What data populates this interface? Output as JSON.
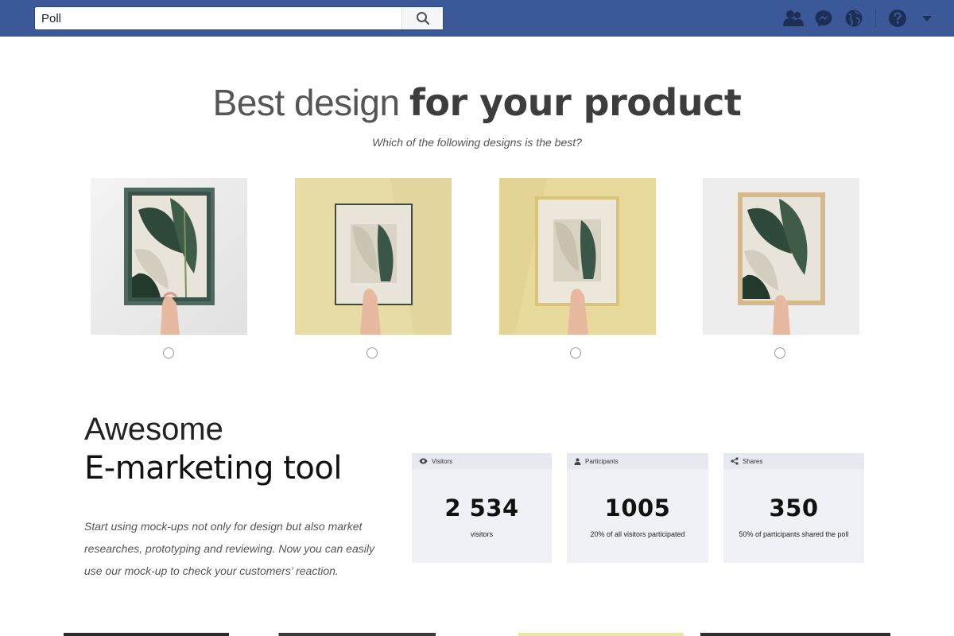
{
  "search": {
    "value": "Poll"
  },
  "nav": {
    "icons": [
      "friends-icon",
      "messenger-icon",
      "globe-icon",
      "help-icon",
      "caret-down-icon"
    ]
  },
  "hero": {
    "title_light": "Best design ",
    "title_bold": "for your product",
    "subtitle": "Which of the following designs is the best?"
  },
  "designs": [
    {
      "frame": "dark green frame",
      "bg": "#efefef",
      "frame_color": "#4f6a61"
    },
    {
      "frame": "thin dark frame with mat",
      "bg": "#e5d8a0",
      "frame_color": "#3d4a3a"
    },
    {
      "frame": "gold frame with mat",
      "bg": "#e6d79c",
      "frame_color": "#d8c47a"
    },
    {
      "frame": "light wood frame",
      "bg": "#eeeeee",
      "frame_color": "#d7b98d"
    }
  ],
  "marketing": {
    "line1": "Awesome",
    "line2": "E-marketing tool",
    "description": "Start using mock-ups not only for design but also market researches, prototyping and reviewing. Now you can easily use our mock-up to check your customers’ reaction."
  },
  "stats": [
    {
      "label": "Visitors",
      "icon": "eye-icon",
      "value": "2 534",
      "note": "visitors"
    },
    {
      "label": "Participants",
      "icon": "user-icon",
      "value": "1005",
      "note": "20% of all visitors participated"
    },
    {
      "label": "Shares",
      "icon": "share-icon",
      "value": "350",
      "note": "50% of participants shared the poll"
    }
  ],
  "colors": {
    "topbar": "#3b5998",
    "card_bg": "#eff1f6"
  }
}
